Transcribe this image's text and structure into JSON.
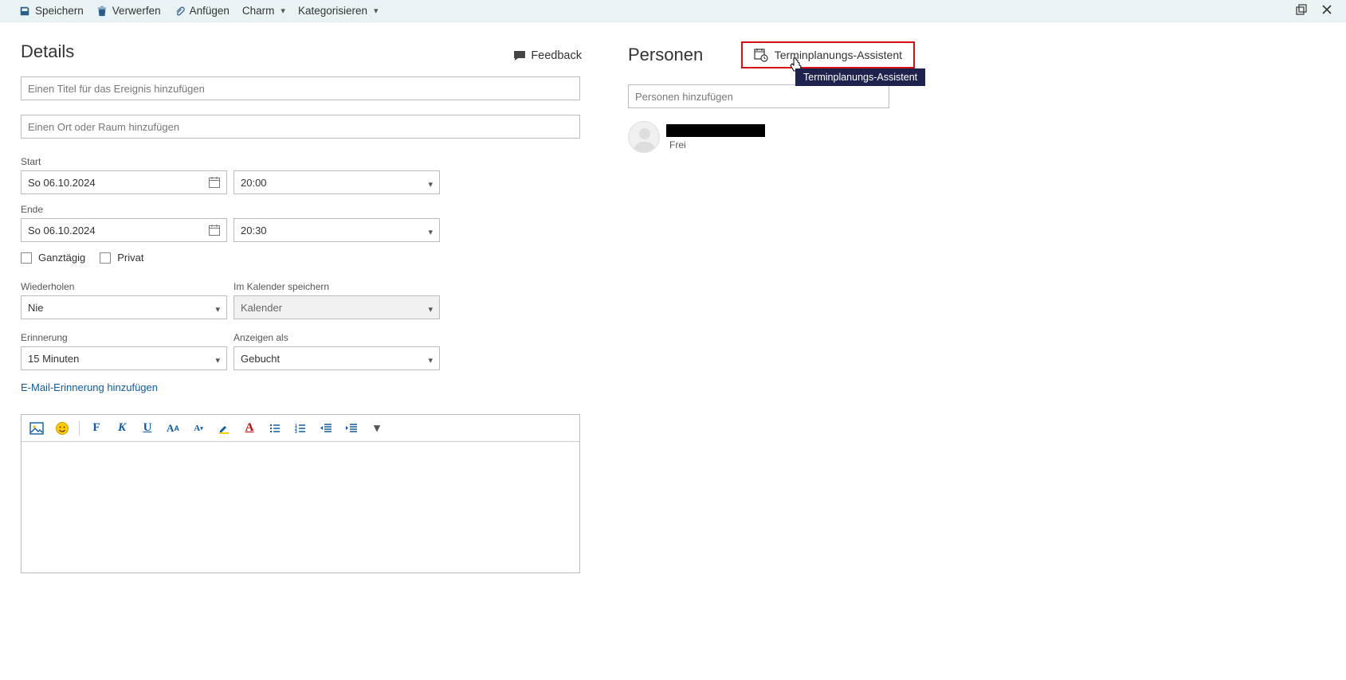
{
  "toolbar": {
    "save": "Speichern",
    "discard": "Verwerfen",
    "attach": "Anfügen",
    "charm": "Charm",
    "categorize": "Kategorisieren"
  },
  "details": {
    "heading": "Details",
    "feedback": "Feedback",
    "title_placeholder": "Einen Titel für das Ereignis hinzufügen",
    "location_placeholder": "Einen Ort oder Raum hinzufügen",
    "start_label": "Start",
    "end_label": "Ende",
    "start_date": "So 06.10.2024",
    "start_time": "20:00",
    "end_date": "So 06.10.2024",
    "end_time": "20:30",
    "allday": "Ganztägig",
    "private": "Privat",
    "repeat_label": "Wiederholen",
    "repeat_value": "Nie",
    "save_in_label": "Im Kalender speichern",
    "save_in_value": "Kalender",
    "reminder_label": "Erinnerung",
    "reminder_value": "15 Minuten",
    "show_as_label": "Anzeigen als",
    "show_as_value": "Gebucht",
    "email_reminder_link": "E-Mail-Erinnerung hinzufügen"
  },
  "editor": {
    "body": ""
  },
  "people": {
    "heading": "Personen",
    "sched_assistant": "Terminplanungs-Assistent",
    "tooltip": "Terminplanungs-Assistent",
    "add_placeholder": "Personen hinzufügen",
    "attendee_status": "Frei"
  }
}
